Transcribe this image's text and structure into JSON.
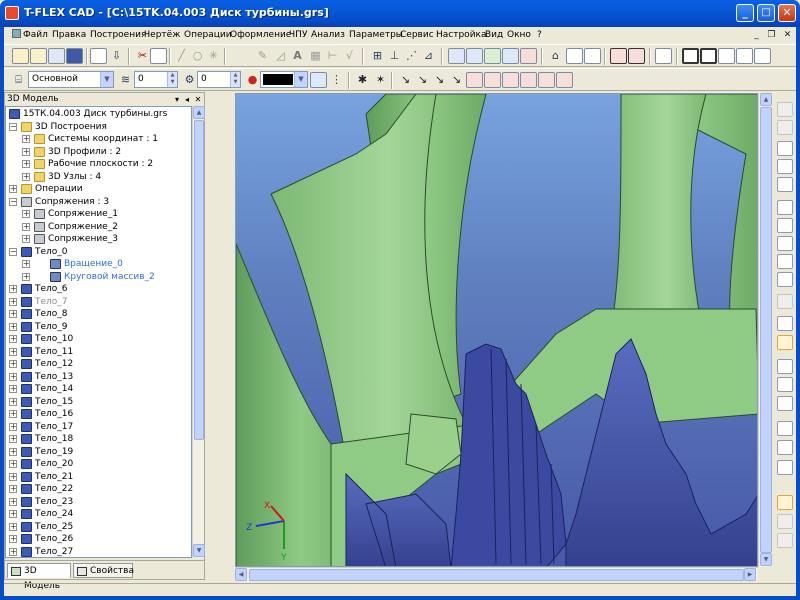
{
  "window": {
    "title": "T-FLEX CAD - [C:\\15TK.04.003 Диск турбины.grs]",
    "controls": {
      "minimize": "_",
      "maximize": "□",
      "close": "✕"
    }
  },
  "menu": {
    "items": [
      "Файл",
      "Правка",
      "Построения",
      "Чертёж",
      "Операции",
      "Оформление",
      "ЧПУ",
      "Анализ",
      "Параметры",
      "Сервис",
      "Настройка",
      "Вид",
      "Окно",
      "?"
    ],
    "mdi_controls": {
      "minimize": "_",
      "restore": "❐",
      "close": "✕"
    }
  },
  "properties_toolbar": {
    "layer_value": "Основной",
    "level_value": "0",
    "priority_value": "0",
    "color_value": "#000000"
  },
  "panel": {
    "title": "3D Модель",
    "header_buttons": {
      "pin": "▾",
      "float": "◂",
      "close": "✕"
    },
    "root": "15ТК.04.003 Диск турбины.grs",
    "tabs": {
      "model": "3D Модель",
      "properties": "Свойства"
    }
  },
  "tree": [
    {
      "label": "3D Построения",
      "level": 1,
      "exp": "−",
      "icon": "folder",
      "color": "#000000"
    },
    {
      "label": "Системы координат : 1",
      "level": 2,
      "exp": "+",
      "icon": "folder",
      "color": "#000000"
    },
    {
      "label": "3D Профили : 2",
      "level": 2,
      "exp": "+",
      "icon": "folder",
      "color": "#000000"
    },
    {
      "label": "Рабочие плоскости : 2",
      "level": 2,
      "exp": "+",
      "icon": "folder",
      "color": "#000000"
    },
    {
      "label": "3D Узлы : 4",
      "level": 2,
      "exp": "+",
      "icon": "folder",
      "color": "#000000"
    },
    {
      "label": "Операции",
      "level": 1,
      "exp": "+",
      "icon": "folder",
      "color": "#000000"
    },
    {
      "label": "Сопряжения : 3",
      "level": 1,
      "exp": "−",
      "icon": "mate",
      "color": "#000000"
    },
    {
      "label": "Сопряжение_1",
      "level": 2,
      "exp": "+",
      "icon": "mate",
      "color": "#000000"
    },
    {
      "label": "Сопряжение_2",
      "level": 2,
      "exp": "+",
      "icon": "mate",
      "color": "#000000"
    },
    {
      "label": "Сопряжение_3",
      "level": 2,
      "exp": "+",
      "icon": "mate",
      "color": "#000000"
    },
    {
      "label": "Тело_0",
      "level": 1,
      "exp": "−",
      "icon": "part",
      "color": "#000000"
    },
    {
      "label": "Вращение_0",
      "level": 3,
      "exp": "+",
      "icon": "op",
      "color": "#2E6FD9"
    },
    {
      "label": "Круговой массив_2",
      "level": 3,
      "exp": "+",
      "icon": "op",
      "color": "#2E6FD9"
    },
    {
      "label": "Тело_6",
      "level": 1,
      "exp": "+",
      "icon": "part",
      "color": "#000000"
    },
    {
      "label": "Тело_7",
      "level": 1,
      "exp": "+",
      "icon": "part",
      "color": "#8A8A8A"
    },
    {
      "label": "Тело_8",
      "level": 1,
      "exp": "+",
      "icon": "part",
      "color": "#000000"
    },
    {
      "label": "Тело_9",
      "level": 1,
      "exp": "+",
      "icon": "part",
      "color": "#000000"
    },
    {
      "label": "Тело_10",
      "level": 1,
      "exp": "+",
      "icon": "part",
      "color": "#000000"
    },
    {
      "label": "Тело_11",
      "level": 1,
      "exp": "+",
      "icon": "part",
      "color": "#000000"
    },
    {
      "label": "Тело_12",
      "level": 1,
      "exp": "+",
      "icon": "part",
      "color": "#000000"
    },
    {
      "label": "Тело_13",
      "level": 1,
      "exp": "+",
      "icon": "part",
      "color": "#000000"
    },
    {
      "label": "Тело_14",
      "level": 1,
      "exp": "+",
      "icon": "part",
      "color": "#000000"
    },
    {
      "label": "Тело_15",
      "level": 1,
      "exp": "+",
      "icon": "part",
      "color": "#000000"
    },
    {
      "label": "Тело_16",
      "level": 1,
      "exp": "+",
      "icon": "part",
      "color": "#000000"
    },
    {
      "label": "Тело_17",
      "level": 1,
      "exp": "+",
      "icon": "part",
      "color": "#000000"
    },
    {
      "label": "Тело_18",
      "level": 1,
      "exp": "+",
      "icon": "part",
      "color": "#000000"
    },
    {
      "label": "Тело_19",
      "level": 1,
      "exp": "+",
      "icon": "part",
      "color": "#000000"
    },
    {
      "label": "Тело_20",
      "level": 1,
      "exp": "+",
      "icon": "part",
      "color": "#000000"
    },
    {
      "label": "Тело_21",
      "level": 1,
      "exp": "+",
      "icon": "part",
      "color": "#000000"
    },
    {
      "label": "Тело_22",
      "level": 1,
      "exp": "+",
      "icon": "part",
      "color": "#000000"
    },
    {
      "label": "Тело_23",
      "level": 1,
      "exp": "+",
      "icon": "part",
      "color": "#000000"
    },
    {
      "label": "Тело_24",
      "level": 1,
      "exp": "+",
      "icon": "part",
      "color": "#000000"
    },
    {
      "label": "Тело_25",
      "level": 1,
      "exp": "+",
      "icon": "part",
      "color": "#000000"
    },
    {
      "label": "Тело_26",
      "level": 1,
      "exp": "+",
      "icon": "part",
      "color": "#000000"
    },
    {
      "label": "Тело_27",
      "level": 1,
      "exp": "+",
      "icon": "part",
      "color": "#000000"
    }
  ],
  "viewport": {
    "triad": {
      "x": "X",
      "y": "Y",
      "z": "Z"
    },
    "colors": {
      "blade": "#8FCB85",
      "disk": "#4A5BAE",
      "background_top": "#78A3DF",
      "background_bottom": "#4858A8"
    }
  }
}
